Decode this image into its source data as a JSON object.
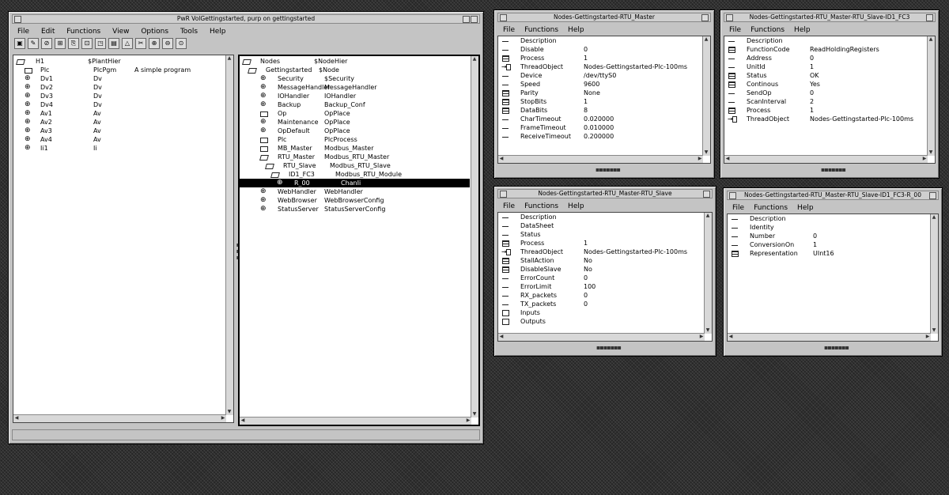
{
  "main_window": {
    "title": "PwR VolGettingstarted,   purp on gettingstarted",
    "menu": [
      "File",
      "Edit",
      "Functions",
      "View",
      "Options",
      "Tools",
      "Help"
    ],
    "toolbar_icons": [
      "save-icon",
      "edit-icon",
      "link-icon",
      "tree-icon",
      "copy-icon",
      "print-icon",
      "open-object-icon",
      "book-icon",
      "triangle-icon",
      "cut-icon",
      "zoom-in-icon",
      "zoom-out-icon",
      "zoom-reset-icon"
    ],
    "left_tree": [
      {
        "icon": "open",
        "name": "H1",
        "class": "$PlantHier",
        "desc": "",
        "indent": 0
      },
      {
        "icon": "folder",
        "name": "Plc",
        "class": "PlcPgm",
        "desc": "A simple program",
        "indent": 1
      },
      {
        "icon": "gear",
        "name": "Dv1",
        "class": "Dv",
        "desc": "",
        "indent": 1
      },
      {
        "icon": "gear",
        "name": "Dv2",
        "class": "Dv",
        "desc": "",
        "indent": 1
      },
      {
        "icon": "gear",
        "name": "Dv3",
        "class": "Dv",
        "desc": "",
        "indent": 1
      },
      {
        "icon": "gear",
        "name": "Dv4",
        "class": "Dv",
        "desc": "",
        "indent": 1
      },
      {
        "icon": "gear",
        "name": "Av1",
        "class": "Av",
        "desc": "",
        "indent": 1
      },
      {
        "icon": "gear",
        "name": "Av2",
        "class": "Av",
        "desc": "",
        "indent": 1
      },
      {
        "icon": "gear",
        "name": "Av3",
        "class": "Av",
        "desc": "",
        "indent": 1
      },
      {
        "icon": "gear",
        "name": "Av4",
        "class": "Av",
        "desc": "",
        "indent": 1
      },
      {
        "icon": "gear",
        "name": "Ii1",
        "class": "Ii",
        "desc": "",
        "indent": 1
      }
    ],
    "right_tree": [
      {
        "icon": "open",
        "name": "Nodes",
        "class": "$NodeHier",
        "indent": 0
      },
      {
        "icon": "open",
        "name": "Gettingstarted",
        "class": "$Node",
        "indent": 1
      },
      {
        "icon": "gear",
        "name": "Security",
        "class": "$Security",
        "indent": 2
      },
      {
        "icon": "gear",
        "name": "MessageHandler",
        "class": "MessageHandler",
        "indent": 2
      },
      {
        "icon": "gear",
        "name": "IOHandler",
        "class": "IOHandler",
        "indent": 2
      },
      {
        "icon": "gear",
        "name": "Backup",
        "class": "Backup_Conf",
        "indent": 2
      },
      {
        "icon": "folder",
        "name": "Op",
        "class": "OpPlace",
        "indent": 2
      },
      {
        "icon": "gear",
        "name": "Maintenance",
        "class": "OpPlace",
        "indent": 2
      },
      {
        "icon": "gear",
        "name": "OpDefault",
        "class": "OpPlace",
        "indent": 2
      },
      {
        "icon": "folder",
        "name": "Plc",
        "class": "PlcProcess",
        "indent": 2
      },
      {
        "icon": "folder",
        "name": "MB_Master",
        "class": "Modbus_Master",
        "indent": 2
      },
      {
        "icon": "open",
        "name": "RTU_Master",
        "class": "Modbus_RTU_Master",
        "indent": 2
      },
      {
        "icon": "open",
        "name": "RTU_Slave",
        "class": "Modbus_RTU_Slave",
        "indent": 3
      },
      {
        "icon": "open",
        "name": "ID1_FC3",
        "class": "Modbus_RTU_Module",
        "indent": 4
      },
      {
        "icon": "gear",
        "name": "R_00",
        "class": "ChanIi",
        "indent": 5,
        "selected": true
      },
      {
        "icon": "gear",
        "name": "WebHandler",
        "class": "WebHandler",
        "indent": 2
      },
      {
        "icon": "gear",
        "name": "WebBrowser",
        "class": "WebBrowserConfig",
        "indent": 2
      },
      {
        "icon": "gear",
        "name": "StatusServer",
        "class": "StatusServerConfig",
        "indent": 2
      }
    ]
  },
  "attr_windows": [
    {
      "id": "rtu-master",
      "title": "Nodes-Gettingstarted-RTU_Master",
      "menu": [
        "File",
        "Functions",
        "Help"
      ],
      "rows": [
        {
          "icon": "line",
          "name": "Description",
          "value": ""
        },
        {
          "icon": "line",
          "name": "Disable",
          "value": "0"
        },
        {
          "icon": "grid",
          "name": "Process",
          "value": "1"
        },
        {
          "icon": "arrow",
          "name": "ThreadObject",
          "value": "Nodes-Gettingstarted-Plc-100ms"
        },
        {
          "icon": "line",
          "name": "Device",
          "value": "/dev/ttyS0"
        },
        {
          "icon": "line",
          "name": "Speed",
          "value": "9600"
        },
        {
          "icon": "grid",
          "name": "Parity",
          "value": "None"
        },
        {
          "icon": "grid",
          "name": "StopBits",
          "value": "1"
        },
        {
          "icon": "grid",
          "name": "DataBits",
          "value": "8"
        },
        {
          "icon": "line",
          "name": "CharTimeout",
          "value": "0.020000"
        },
        {
          "icon": "line",
          "name": "FrameTimeout",
          "value": "0.010000"
        },
        {
          "icon": "line",
          "name": "ReceiveTimeout",
          "value": "0.200000"
        }
      ]
    },
    {
      "id": "rtu-slave-fc3",
      "title": "Nodes-Gettingstarted-RTU_Master-RTU_Slave-ID1_FC3",
      "menu": [
        "File",
        "Functions",
        "Help"
      ],
      "rows": [
        {
          "icon": "line",
          "name": "Description",
          "value": ""
        },
        {
          "icon": "grid",
          "name": "FunctionCode",
          "value": "ReadHoldingRegisters"
        },
        {
          "icon": "line",
          "name": "Address",
          "value": "0"
        },
        {
          "icon": "line",
          "name": "UnitId",
          "value": "1"
        },
        {
          "icon": "grid",
          "name": "Status",
          "value": "OK"
        },
        {
          "icon": "grid",
          "name": "Continous",
          "value": "Yes"
        },
        {
          "icon": "line",
          "name": "SendOp",
          "value": "0"
        },
        {
          "icon": "line",
          "name": "ScanInterval",
          "value": "2"
        },
        {
          "icon": "grid",
          "name": "Process",
          "value": "1"
        },
        {
          "icon": "arrow",
          "name": "ThreadObject",
          "value": "Nodes-Gettingstarted-Plc-100ms"
        }
      ]
    },
    {
      "id": "rtu-slave",
      "title": "Nodes-Gettingstarted-RTU_Master-RTU_Slave",
      "menu": [
        "File",
        "Functions",
        "Help"
      ],
      "rows": [
        {
          "icon": "line",
          "name": "Description",
          "value": ""
        },
        {
          "icon": "line",
          "name": "DataSheet",
          "value": ""
        },
        {
          "icon": "line",
          "name": "Status",
          "value": ""
        },
        {
          "icon": "grid",
          "name": "Process",
          "value": "1"
        },
        {
          "icon": "arrow",
          "name": "ThreadObject",
          "value": "Nodes-Gettingstarted-Plc-100ms"
        },
        {
          "icon": "grid",
          "name": "StallAction",
          "value": "No"
        },
        {
          "icon": "grid",
          "name": "DisableSlave",
          "value": "No"
        },
        {
          "icon": "line",
          "name": "ErrorCount",
          "value": "0"
        },
        {
          "icon": "line",
          "name": "ErrorLimit",
          "value": "100"
        },
        {
          "icon": "line",
          "name": "RX_packets",
          "value": "0"
        },
        {
          "icon": "line",
          "name": "TX_packets",
          "value": "0"
        },
        {
          "icon": "box",
          "name": "Inputs",
          "value": ""
        },
        {
          "icon": "box",
          "name": "Outputs",
          "value": ""
        }
      ]
    },
    {
      "id": "r00",
      "title": "Nodes-Gettingstarted-RTU_Master-RTU_Slave-ID1_FC3-R_00",
      "menu": [
        "File",
        "Functions",
        "Help"
      ],
      "rows": [
        {
          "icon": "line",
          "name": "Description",
          "value": ""
        },
        {
          "icon": "line",
          "name": "Identity",
          "value": ""
        },
        {
          "icon": "line",
          "name": "Number",
          "value": "0"
        },
        {
          "icon": "line",
          "name": "ConversionOn",
          "value": "1"
        },
        {
          "icon": "grid",
          "name": "Representation",
          "value": "UInt16"
        }
      ]
    }
  ]
}
